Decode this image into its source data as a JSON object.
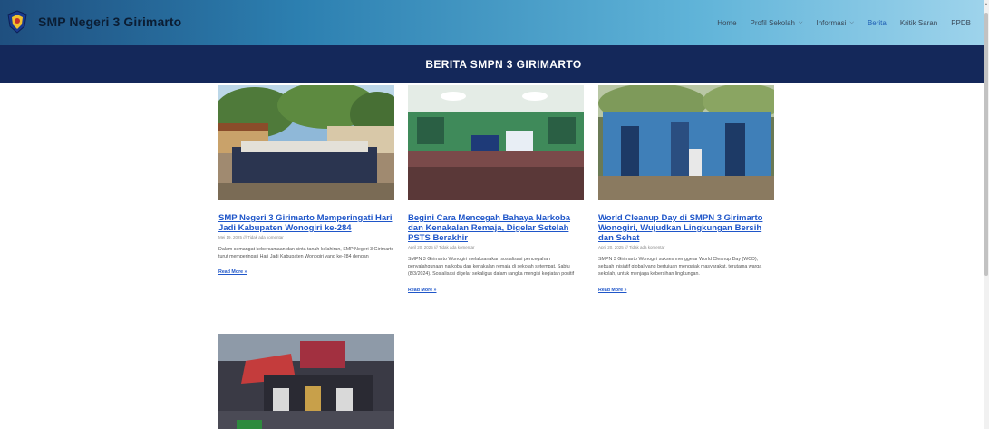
{
  "header": {
    "site_title": "SMP Negeri 3 Girimarto",
    "nav": [
      {
        "label": "Home",
        "dropdown": false,
        "active": false
      },
      {
        "label": "Profil Sekolah",
        "dropdown": true,
        "active": false
      },
      {
        "label": "Informasi",
        "dropdown": true,
        "active": false
      },
      {
        "label": "Berita",
        "dropdown": false,
        "active": true
      },
      {
        "label": "Kritik Saran",
        "dropdown": false,
        "active": false
      },
      {
        "label": "PPDB",
        "dropdown": false,
        "active": false
      }
    ]
  },
  "banner": {
    "title": "BERITA  SMPN 3 GIRIMARTO"
  },
  "posts": [
    {
      "title": "SMP Negeri 3 Girimarto Memperingati Hari Jadi Kabupaten Wonogiri ke-284",
      "meta": "Mei 19, 2025 /// Tidak ada komentar",
      "excerpt": "Dalam semangat kebersamaan dan cinta tanah kelahiran, SMP Negeri 3 Girimarto turut memperingati Hari Jadi Kabupaten Wonogiri yang ke-284 dengan",
      "read_more": "Read More »"
    },
    {
      "title": "Begini Cara Mencegah Bahaya Narkoba dan Kenakalan Remaja, Digelar Setelah PSTS Berakhir",
      "meta": "April 20, 2025 /// Tidak ada komentar",
      "excerpt": "SMPN 3 Girimarto Wonogiri melaksanakan sosialisasi pencegahan penyalahgunaan narkoba dan kenakalan remaja di sekolah setempat, Sabtu (8/3/2024). Sosialisasi digelar sekaligus dalam rangka mengisi kegiatan positif",
      "read_more": "Read More »"
    },
    {
      "title": "World Cleanup Day di SMPN 3 Girimarto Wonogiri, Wujudkan Lingkungan Bersih dan Sehat",
      "meta": "April 20, 2025 /// Tidak ada komentar",
      "excerpt": "SMPN 3 Girimarto Wonogiri sukses menggelar World Cleanup Day (WCD), sebuah inisiatif global yang bertujuan mengajak masyarakat, terutama warga sekolah, untuk menjaga kebersihan lingkungan.",
      "read_more": "Read More »"
    }
  ],
  "colors": {
    "banner_bg": "#14285a",
    "link": "#1f56c9"
  }
}
